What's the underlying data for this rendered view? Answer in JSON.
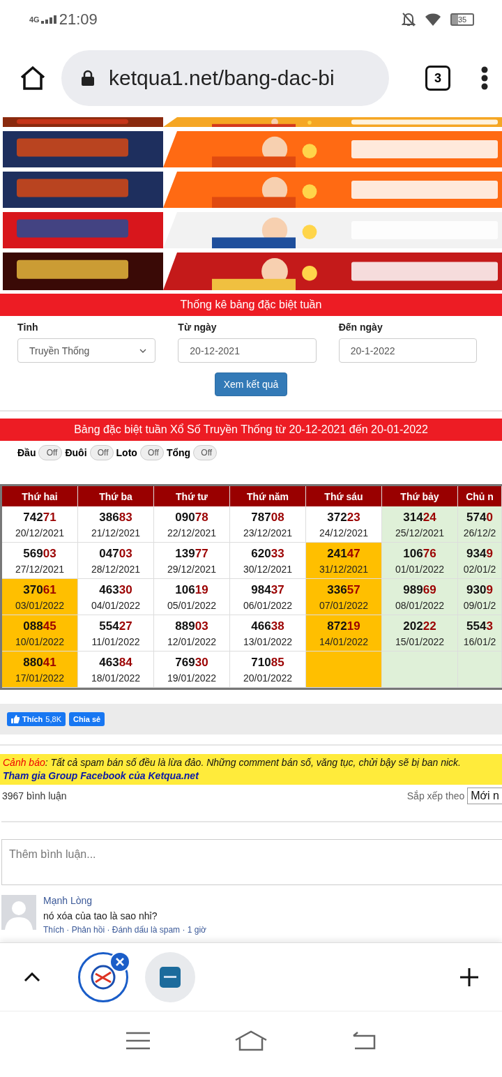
{
  "status_bar": {
    "network": "4G",
    "time": "21:09",
    "battery": "35"
  },
  "browser": {
    "url": "ketqua1.net/bang-dac-bi",
    "tab_count": "3"
  },
  "search_panel": {
    "title": "Thống kê bảng đặc biệt tuần",
    "fields": [
      {
        "label": "Tỉnh",
        "kind": "select",
        "value": "Truyền Thống"
      },
      {
        "label": "Từ ngày",
        "kind": "text",
        "value": "20-12-2021"
      },
      {
        "label": "Đến ngày",
        "kind": "text",
        "value": "20-1-2022"
      }
    ],
    "button": "Xem kết quả"
  },
  "results": {
    "title": "Bảng đặc biệt tuần Xổ Số Truyền Thống từ 20-12-2021 đến 20-01-2022",
    "toggles": [
      {
        "label": "Đầu",
        "state": "Off",
        "on": false
      },
      {
        "label": "Đuôi",
        "state": "Off",
        "on": false
      },
      {
        "label": "Loto",
        "state": "Off",
        "on": false
      },
      {
        "label": "Tổng",
        "state": "Off",
        "on": false
      }
    ],
    "columns": [
      "Thứ hai",
      "Thứ ba",
      "Thứ tư",
      "Thứ năm",
      "Thứ sáu",
      "Thứ bảy",
      "Chủ n"
    ],
    "rows": [
      [
        {
          "head": "742",
          "tail": "71",
          "date": "20/12/2021",
          "color": "#ffffff"
        },
        {
          "head": "386",
          "tail": "83",
          "date": "21/12/2021",
          "color": "#ffffff"
        },
        {
          "head": "090",
          "tail": "78",
          "date": "22/12/2021",
          "color": "#ffffff"
        },
        {
          "head": "787",
          "tail": "08",
          "date": "23/12/2021",
          "color": "#ffffff"
        },
        {
          "head": "372",
          "tail": "23",
          "date": "24/12/2021",
          "color": "#ffffff"
        },
        {
          "head": "314",
          "tail": "24",
          "date": "25/12/2021",
          "color": "#dff0d8"
        },
        {
          "head": "574",
          "tail": "0",
          "date": "26/12/2",
          "color": "#dff0d8"
        }
      ],
      [
        {
          "head": "569",
          "tail": "03",
          "date": "27/12/2021",
          "color": "#ffffff"
        },
        {
          "head": "047",
          "tail": "03",
          "date": "28/12/2021",
          "color": "#ffffff"
        },
        {
          "head": "139",
          "tail": "77",
          "date": "29/12/2021",
          "color": "#ffffff"
        },
        {
          "head": "620",
          "tail": "33",
          "date": "30/12/2021",
          "color": "#ffffff"
        },
        {
          "head": "241",
          "tail": "47",
          "date": "31/12/2021",
          "color": "#ffbf00"
        },
        {
          "head": "106",
          "tail": "76",
          "date": "01/01/2022",
          "color": "#dff0d8"
        },
        {
          "head": "934",
          "tail": "9",
          "date": "02/01/2",
          "color": "#dff0d8"
        }
      ],
      [
        {
          "head": "370",
          "tail": "61",
          "date": "03/01/2022",
          "color": "#ffbf00"
        },
        {
          "head": "463",
          "tail": "30",
          "date": "04/01/2022",
          "color": "#ffffff"
        },
        {
          "head": "106",
          "tail": "19",
          "date": "05/01/2022",
          "color": "#ffffff"
        },
        {
          "head": "984",
          "tail": "37",
          "date": "06/01/2022",
          "color": "#ffffff"
        },
        {
          "head": "336",
          "tail": "57",
          "date": "07/01/2022",
          "color": "#ffbf00"
        },
        {
          "head": "989",
          "tail": "69",
          "date": "08/01/2022",
          "color": "#dff0d8"
        },
        {
          "head": "930",
          "tail": "9",
          "date": "09/01/2",
          "color": "#dff0d8"
        }
      ],
      [
        {
          "head": "088",
          "tail": "45",
          "date": "10/01/2022",
          "color": "#ffbf00"
        },
        {
          "head": "554",
          "tail": "27",
          "date": "11/01/2022",
          "color": "#ffffff"
        },
        {
          "head": "889",
          "tail": "03",
          "date": "12/01/2022",
          "color": "#ffffff"
        },
        {
          "head": "466",
          "tail": "38",
          "date": "13/01/2022",
          "color": "#ffffff"
        },
        {
          "head": "872",
          "tail": "19",
          "date": "14/01/2022",
          "color": "#ffbf00"
        },
        {
          "head": "202",
          "tail": "22",
          "date": "15/01/2022",
          "color": "#dff0d8"
        },
        {
          "head": "554",
          "tail": "3",
          "date": "16/01/2",
          "color": "#dff0d8"
        }
      ],
      [
        {
          "head": "880",
          "tail": "41",
          "date": "17/01/2022",
          "color": "#ffbf00"
        },
        {
          "head": "463",
          "tail": "84",
          "date": "18/01/2022",
          "color": "#ffffff"
        },
        {
          "head": "769",
          "tail": "30",
          "date": "19/01/2022",
          "color": "#ffffff"
        },
        {
          "head": "710",
          "tail": "85",
          "date": "20/01/2022",
          "color": "#ffffff"
        },
        {
          "color": "#ffbf00"
        },
        {
          "color": "#dff0d8"
        },
        {
          "color": "#dff0d8"
        }
      ]
    ]
  },
  "social": {
    "like": "Thích",
    "like_count": "5,8K",
    "share": "Chia sẻ"
  },
  "comments": {
    "warning_label": "Cảnh báo",
    "warning_text": ": Tất cả spam bán số đều là lừa đảo. Những comment bán số, văng tục, chửi bậy sẽ bị ban nick.",
    "group_link": "Tham gia Group Facebook của Ketqua.net",
    "count": "3967 bình luận",
    "sort_label": "Sắp xếp theo",
    "sort_value": "Mới n",
    "placeholder": "Thêm bình luận...",
    "items": [
      {
        "author": "Mạnh Lòng",
        "text": "nó xóa của tao là sao nhỉ?",
        "actions": "Thích · Phản hồi · Đánh dấu là spam · 1 giờ"
      }
    ]
  },
  "tab_strip": {
    "tabs": [
      {
        "selected": true
      },
      {
        "selected": false
      }
    ]
  }
}
